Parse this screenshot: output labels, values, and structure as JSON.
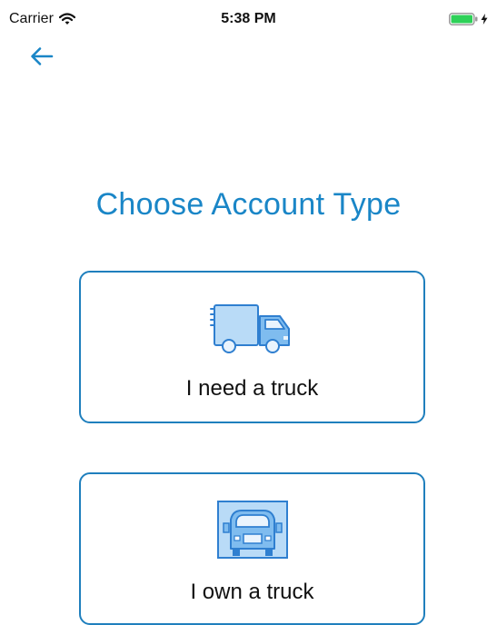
{
  "status_bar": {
    "carrier": "Carrier",
    "time": "5:38 PM",
    "icons": [
      "wifi-icon",
      "battery-icon",
      "charging-bolt-icon"
    ]
  },
  "navigation": {
    "back_icon": "back-arrow-icon"
  },
  "title": "Choose Account Type",
  "options": [
    {
      "label": "I need a truck",
      "icon": "delivery-truck-icon"
    },
    {
      "label": "I own a truck",
      "icon": "truck-front-icon"
    }
  ],
  "colors": {
    "accent": "#1a86c7",
    "card_border": "#1f7fbd",
    "icon_fill_light": "#b9dbf7",
    "icon_fill_mid": "#7fbcef",
    "icon_stroke": "#2f7fd0",
    "battery_green": "#2ed158"
  }
}
